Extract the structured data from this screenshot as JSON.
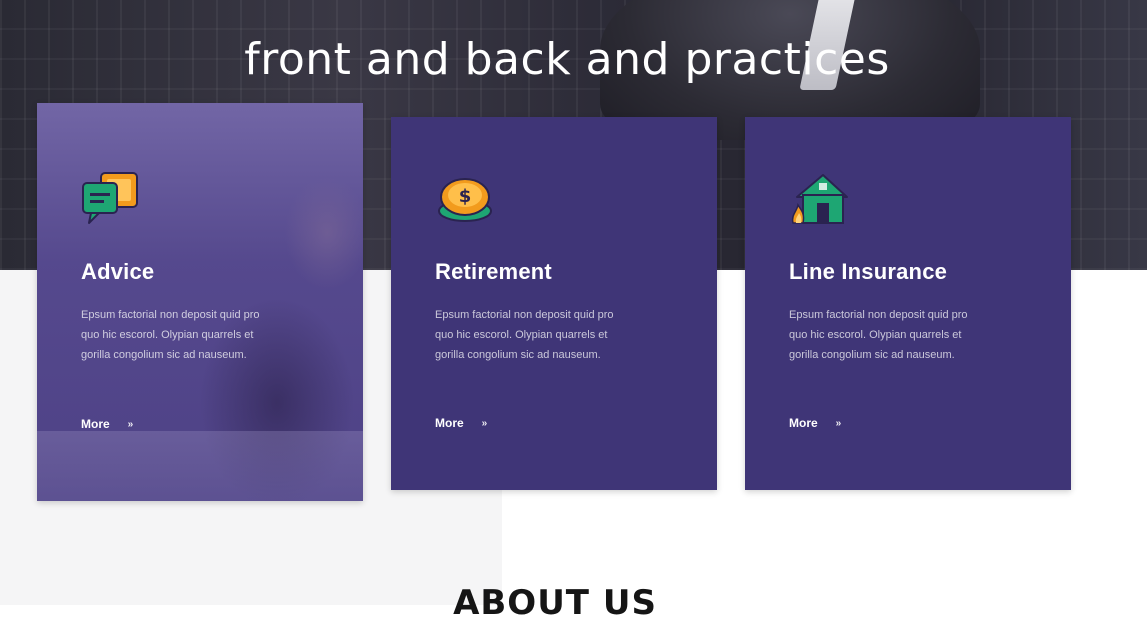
{
  "hero": {
    "title": "front and back and practices"
  },
  "cards": [
    {
      "icon": "chat-bubbles-icon",
      "title": "Advice",
      "text": "Epsum factorial non deposit quid pro\nquo hic escorol. Olypian quarrels et\ngorilla congolium sic ad nauseum.",
      "more": "More",
      "more_arrow": "»"
    },
    {
      "icon": "coin-money-icon",
      "title": "Retirement",
      "text": "Epsum factorial non deposit quid pro\nquo hic escorol. Olypian quarrels et\ngorilla congolium sic ad nauseum.",
      "more": "More",
      "more_arrow": "»"
    },
    {
      "icon": "house-fire-icon",
      "title": "Line Insurance",
      "text": "Epsum factorial non deposit quid pro\nquo hic escorol. Olypian quarrels et\ngorilla congolium sic ad nauseum.",
      "more": "More",
      "more_arrow": "»"
    }
  ],
  "about": {
    "heading": "ABOUT US"
  },
  "colors": {
    "card_purple": "#3f3577",
    "hero_dark": "#2b2a36",
    "icon_green": "#1ea673",
    "icon_orange": "#f29b1d"
  }
}
